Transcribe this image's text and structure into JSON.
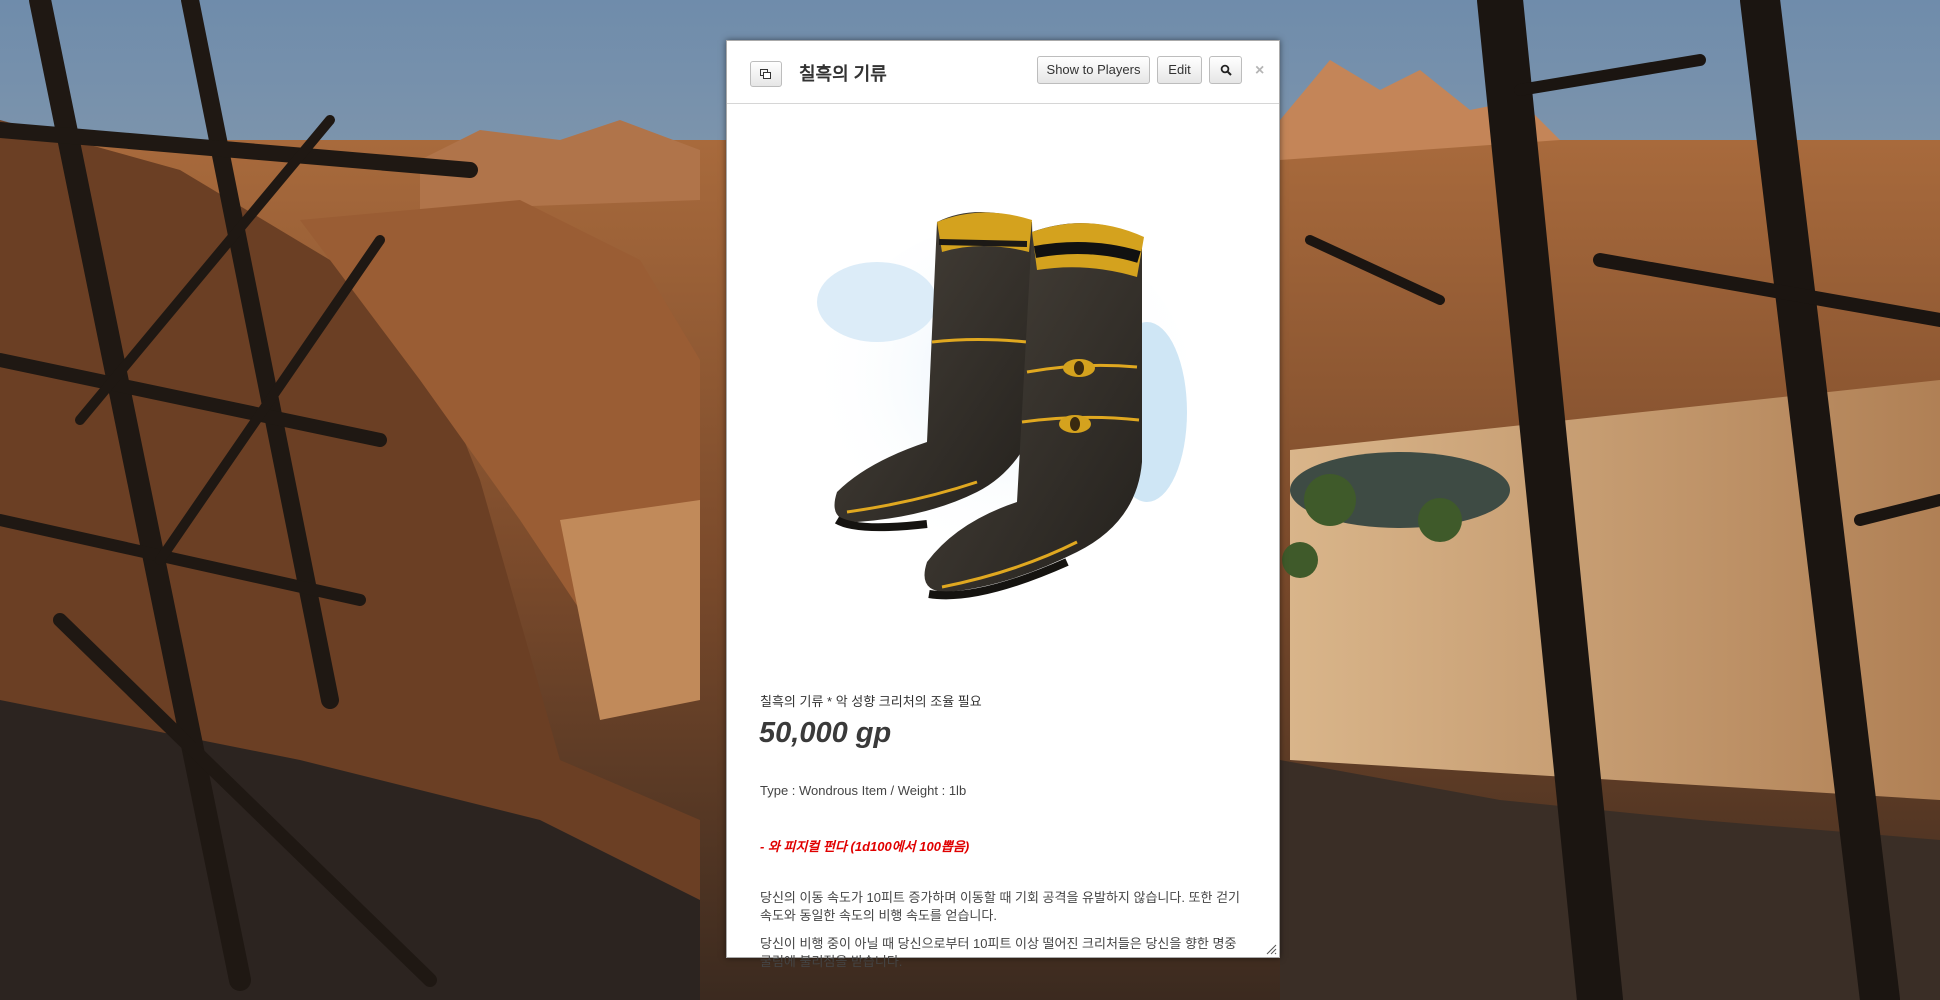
{
  "window": {
    "title": "칠흑의 기류",
    "show_to_players_label": "Show to Players",
    "edit_label": "Edit",
    "close_glyph": "×"
  },
  "item": {
    "subtitle": "칠흑의 기류  * 악 성향 크리처의 조율 필요",
    "price": "50,000 gp",
    "meta": "Type : Wondrous Item / Weight : 1lb",
    "bonus": "- 와 피지컬 펀다 (1d100에서 100뽑음)",
    "description": [
      "당신의 이동 속도가 10피트 증가하며 이동할 때 기회 공격을 유발하지 않습니다. 또한 걷기 속도와 동일한 속도의 비행 속도를 얻습니다.",
      "당신이 비행 중이 아닐 때 당신으로부터 10피트 이상 떨어진 크리처들은 당신을 향한 명중 굴림에 불리점을 받습니다."
    ]
  },
  "icons": {
    "popout": "popout-icon",
    "search": "search-icon",
    "resize": "resize-grip-icon"
  },
  "colors": {
    "bonus_text": "#e00000",
    "boot_leather": "#3a3630",
    "boot_trim": "#e0a820",
    "aura": "#cfe6f5"
  }
}
